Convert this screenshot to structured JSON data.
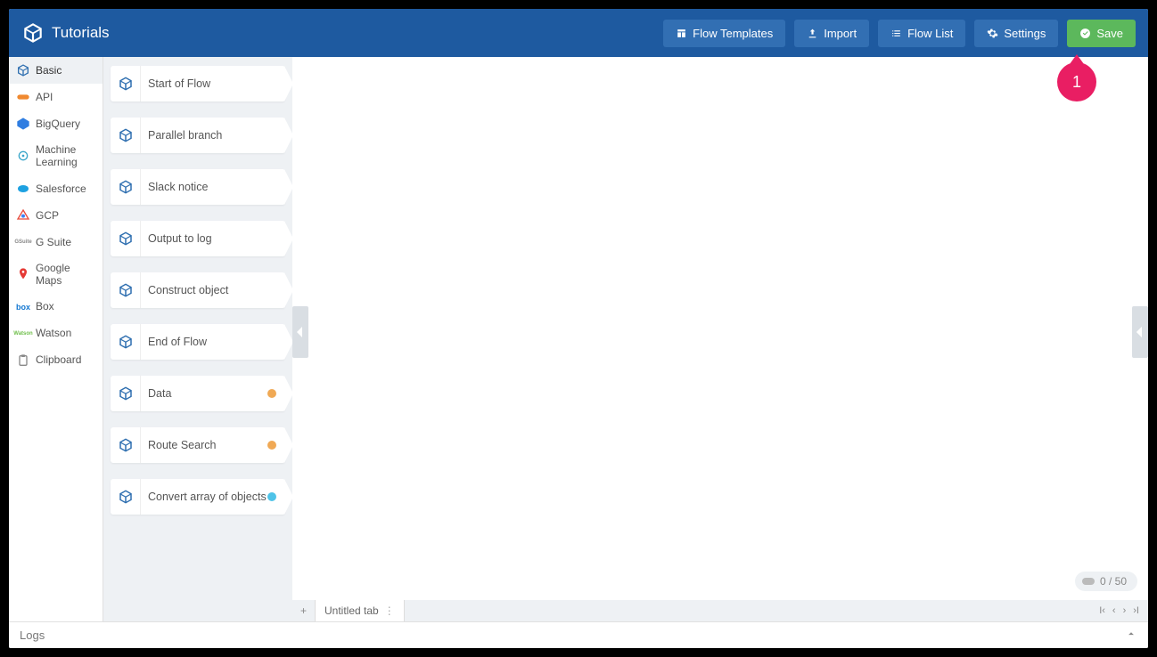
{
  "header": {
    "title": "Tutorials",
    "buttons": {
      "flow_templates": "Flow Templates",
      "import": "Import",
      "flow_list": "Flow List",
      "settings": "Settings",
      "save": "Save"
    }
  },
  "leftnav": {
    "items": [
      {
        "label": "Basic",
        "icon": "cube",
        "active": true
      },
      {
        "label": "API",
        "icon": "api",
        "active": false
      },
      {
        "label": "BigQuery",
        "icon": "bigquery",
        "active": false
      },
      {
        "label": "Machine Learning",
        "icon": "ml",
        "active": false
      },
      {
        "label": "Salesforce",
        "icon": "salesforce",
        "active": false
      },
      {
        "label": "GCP",
        "icon": "gcp",
        "active": false
      },
      {
        "label": "G Suite",
        "icon": "gsuite",
        "active": false
      },
      {
        "label": "Google Maps",
        "icon": "maps",
        "active": false
      },
      {
        "label": "Box",
        "icon": "box",
        "active": false
      },
      {
        "label": "Watson",
        "icon": "watson",
        "active": false
      },
      {
        "label": "Clipboard",
        "icon": "clipboard",
        "active": false
      }
    ]
  },
  "palette": {
    "nodes": [
      {
        "label": "Start of Flow",
        "badge": null
      },
      {
        "label": "Parallel branch",
        "badge": null
      },
      {
        "label": "Slack notice",
        "badge": null
      },
      {
        "label": "Output to log",
        "badge": null
      },
      {
        "label": "Construct object",
        "badge": null
      },
      {
        "label": "End of Flow",
        "badge": null
      },
      {
        "label": "Data",
        "badge": "#f0a955"
      },
      {
        "label": "Route Search",
        "badge": "#f0a955"
      },
      {
        "label": "Convert array of objects",
        "badge": "#4fc3e8"
      }
    ]
  },
  "canvas": {
    "step_marker": "1",
    "counter": "0 / 50"
  },
  "tabs": {
    "active": "Untitled tab"
  },
  "footer": {
    "logs_label": "Logs"
  }
}
